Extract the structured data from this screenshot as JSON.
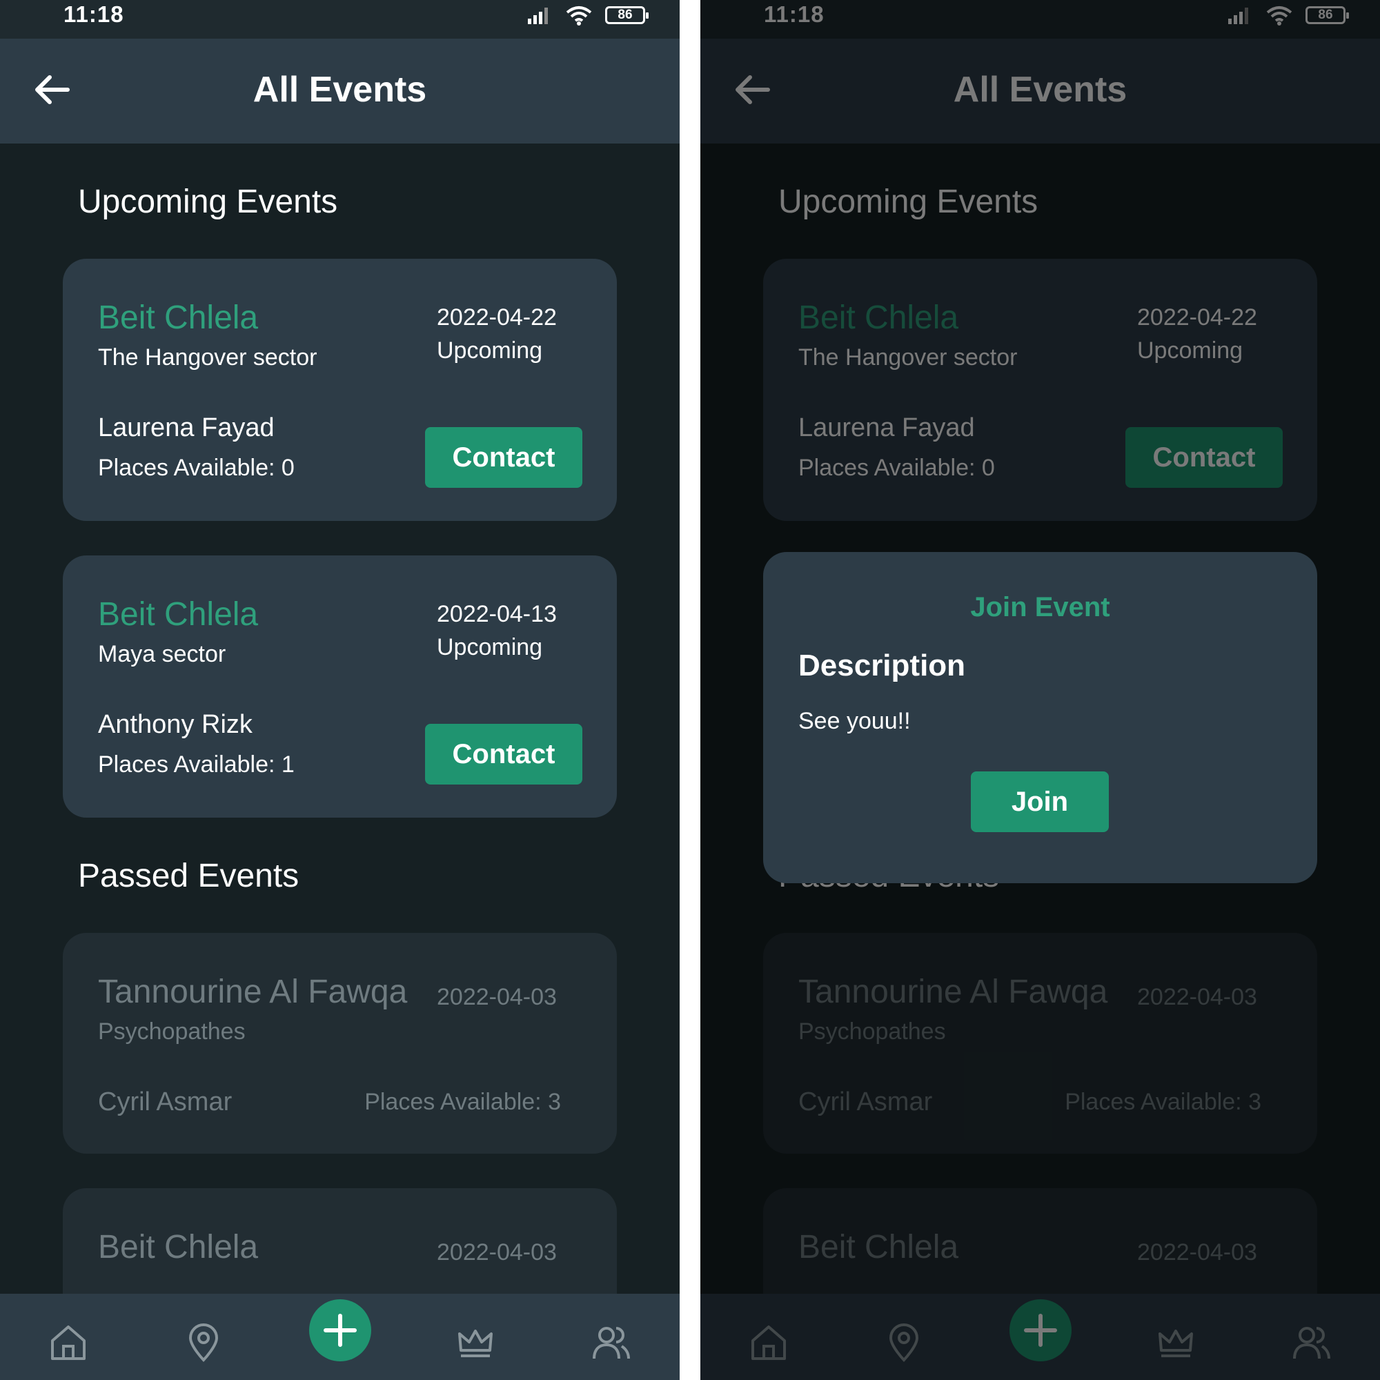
{
  "status_bar": {
    "time": "11:18",
    "battery": "86"
  },
  "header": {
    "title": "All Events"
  },
  "sections": {
    "upcoming": "Upcoming Events",
    "passed": "Passed Events"
  },
  "upcoming_events": [
    {
      "name": "Beit Chlela",
      "sector": "The Hangover sector",
      "date": "2022-04-22",
      "status": "Upcoming",
      "host": "Laurena Fayad",
      "places": "Places Available: 0",
      "button": "Contact"
    },
    {
      "name": "Beit Chlela",
      "sector": "Maya sector",
      "date": "2022-04-13",
      "status": "Upcoming",
      "host": "Anthony Rizk",
      "places": "Places Available: 1",
      "button": "Contact"
    }
  ],
  "passed_events": [
    {
      "name": "Tannourine Al Fawqa",
      "sector": "Psychopathes",
      "date": "2022-04-03",
      "host": "Cyril Asmar",
      "places": "Places Available: 3"
    },
    {
      "name": "Beit Chlela",
      "date": "2022-04-03"
    }
  ],
  "dialog": {
    "title": "Join Event",
    "label": "Description",
    "text": "See youu!!",
    "button": "Join"
  },
  "nav": {
    "items": [
      "home-icon",
      "location-pin-icon",
      "add-icon",
      "crown-icon",
      "users-icon"
    ]
  },
  "colors": {
    "accent": "#1f9470",
    "accent_text": "#2fa07c",
    "surface": "#2d3c47",
    "background": "#162023"
  }
}
